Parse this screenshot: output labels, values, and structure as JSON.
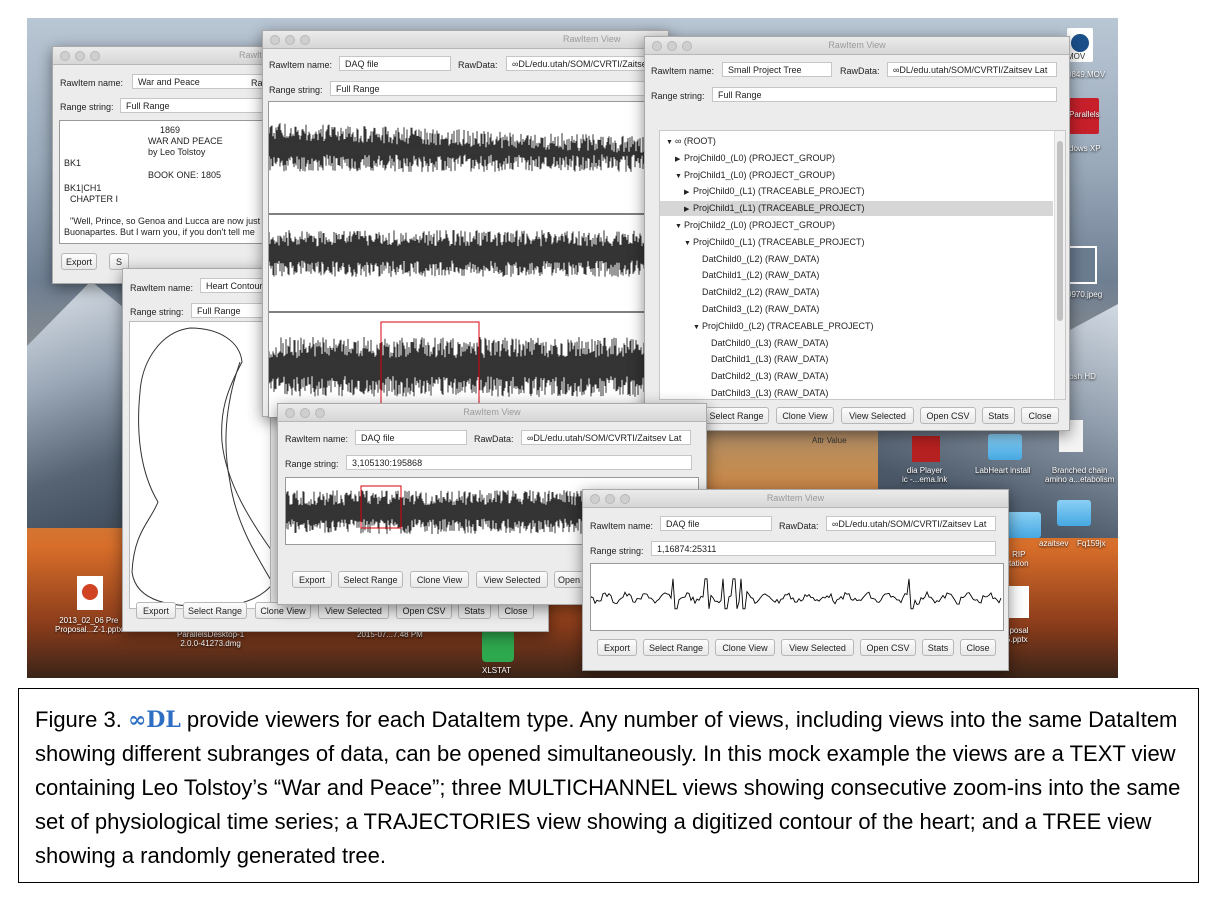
{
  "desktop": {
    "icons": [
      {
        "label": "MOV"
      },
      {
        "label": "0849.MOV"
      },
      {
        "label": "Parallels"
      },
      {
        "label": "dows XP"
      },
      {
        "label": "0970.jpeg"
      },
      {
        "label": "tosh HD"
      },
      {
        "label": "Attr Value"
      },
      {
        "label": "dia Player\nic -...ema.lnk"
      },
      {
        "label": "LabHeart install"
      },
      {
        "label": "Branched chain\namino a...etabolism"
      },
      {
        "label": "RIP\ntation"
      },
      {
        "label": "azaitsev"
      },
      {
        "label": "Fq159jx"
      },
      {
        "label": "2013_02_06 Pre\nProposal...Z-1.pptx"
      },
      {
        "label": "ParallelsDesktop-1\n2.0.0-41273.dmg"
      },
      {
        "label": "2015-07...7.48 PM"
      },
      {
        "label": "XLSTAT"
      },
      {
        "label": "oposal\n5.pptx"
      }
    ]
  },
  "common": {
    "rawitem_label": "RawItem name:",
    "rawdata_label": "RawData:",
    "range_label": "Range string:",
    "window_title": "RawItem View",
    "window_title_short": "RawIt",
    "rawdata_short": "Raw"
  },
  "buttons": {
    "export": "Export",
    "select_range": "Select Range",
    "clone_view": "Clone View",
    "view_selected": "View Selected",
    "open_csv": "Open CSV",
    "stats": "Stats",
    "close": "Close",
    "partial_s": "S",
    "partial_open": "Open"
  },
  "text_view": {
    "name": "War and Peace",
    "range": "Full Range",
    "lines": [
      "1869",
      "WAR AND PEACE",
      "by Leo Tolstoy",
      "BK1",
      "BOOK ONE: 1805",
      "BK1|CH1",
      "CHAPTER I",
      "\"Well, Prince, so Genoa and Lucca are now just",
      "Buonapartes. But I warn you, if you don't tell me"
    ]
  },
  "heart_view": {
    "name": "Heart Contour",
    "range": "Full Range"
  },
  "daq_full": {
    "name": "DAQ file",
    "rawdata": "∞DL/edu.utah/SOM/CVRTI/Zaitsev",
    "range": "Full Range"
  },
  "daq_zoom1": {
    "name": "DAQ file",
    "rawdata": "∞DL/edu.utah/SOM/CVRTI/Zaitsev Lat",
    "range": "3,105130:195868"
  },
  "daq_zoom2": {
    "name": "DAQ file",
    "rawdata": "∞DL/edu.utah/SOM/CVRTI/Zaitsev Lat",
    "range": "1,16874:25311"
  },
  "tree_view": {
    "name": "Small Project Tree",
    "rawdata": "∞DL/edu.utah/SOM/CVRTI/Zaitsev Lat",
    "range": "Full Range",
    "nodes": [
      {
        "indent": 0,
        "arrow": "▼",
        "text": "∞ (ROOT)"
      },
      {
        "indent": 1,
        "arrow": "▶",
        "text": "ProjChild0_(L0) (PROJECT_GROUP)"
      },
      {
        "indent": 1,
        "arrow": "▼",
        "text": "ProjChild1_(L0) (PROJECT_GROUP)"
      },
      {
        "indent": 2,
        "arrow": "▶",
        "text": "ProjChild0_(L1) (TRACEABLE_PROJECT)"
      },
      {
        "indent": 2,
        "arrow": "▶",
        "text": "ProjChild1_(L1) (TRACEABLE_PROJECT)",
        "selected": true
      },
      {
        "indent": 1,
        "arrow": "▼",
        "text": "ProjChild2_(L0) (PROJECT_GROUP)"
      },
      {
        "indent": 2,
        "arrow": "▼",
        "text": "ProjChild0_(L1) (TRACEABLE_PROJECT)"
      },
      {
        "indent": 3,
        "arrow": "",
        "text": "DatChild0_(L2) (RAW_DATA)"
      },
      {
        "indent": 3,
        "arrow": "",
        "text": "DatChild1_(L2) (RAW_DATA)"
      },
      {
        "indent": 3,
        "arrow": "",
        "text": "DatChild2_(L2) (RAW_DATA)"
      },
      {
        "indent": 3,
        "arrow": "",
        "text": "DatChild3_(L2) (RAW_DATA)"
      },
      {
        "indent": 3,
        "arrow": "▼",
        "text": "ProjChild0_(L2) (TRACEABLE_PROJECT)"
      },
      {
        "indent": 4,
        "arrow": "",
        "text": "DatChild0_(L3) (RAW_DATA)"
      },
      {
        "indent": 4,
        "arrow": "",
        "text": "DatChild1_(L3) (RAW_DATA)"
      },
      {
        "indent": 4,
        "arrow": "",
        "text": "DatChild2_(L3) (RAW_DATA)"
      },
      {
        "indent": 4,
        "arrow": "",
        "text": "DatChild3_(L3) (RAW_DATA)"
      }
    ]
  },
  "caption": {
    "prefix": "Figure 3.  ",
    "logo": "∞DL",
    "text": " provide viewers for each DataItem type. Any number of views, including views into the same DataItem showing different subranges of data, can be opened simultaneously. In this mock example the views are a TEXT view containing Leo Tolstoy’s “War and Peace”; three MULTICHANNEL views showing consecutive zoom-ins into the same set of physiological time series; a TRAJECTORIES view showing a digitized contour of the heart; and a TREE view showing a randomly generated tree."
  },
  "colors": {
    "selection_box": "#d9000d",
    "logo": "#2E6FC4",
    "tree_selected": "#d6d6d6"
  }
}
